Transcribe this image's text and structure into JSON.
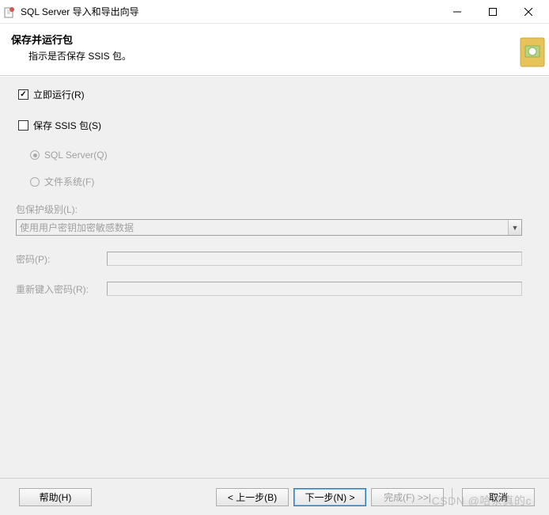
{
  "window": {
    "title": "SQL Server 导入和导出向导"
  },
  "header": {
    "title": "保存并运行包",
    "subtitle": "指示是否保存 SSIS 包。"
  },
  "options": {
    "run_now": "立即运行(R)",
    "save_ssis": "保存 SSIS 包(S)",
    "target_sql": "SQL Server(Q)",
    "target_fs": "文件系统(F)"
  },
  "protection": {
    "label": "包保护级别(L):",
    "value": "使用用户密钥加密敏感数据"
  },
  "password": {
    "label": "密码(P):",
    "retype_label": "重新键入密码(R):"
  },
  "buttons": {
    "help": "帮助(H)",
    "back": "< 上一步(B)",
    "next": "下一步(N) >",
    "finish": "完成(F) >>|",
    "cancel": "取消"
  },
  "watermark": "CSDN @哈茶真的c"
}
